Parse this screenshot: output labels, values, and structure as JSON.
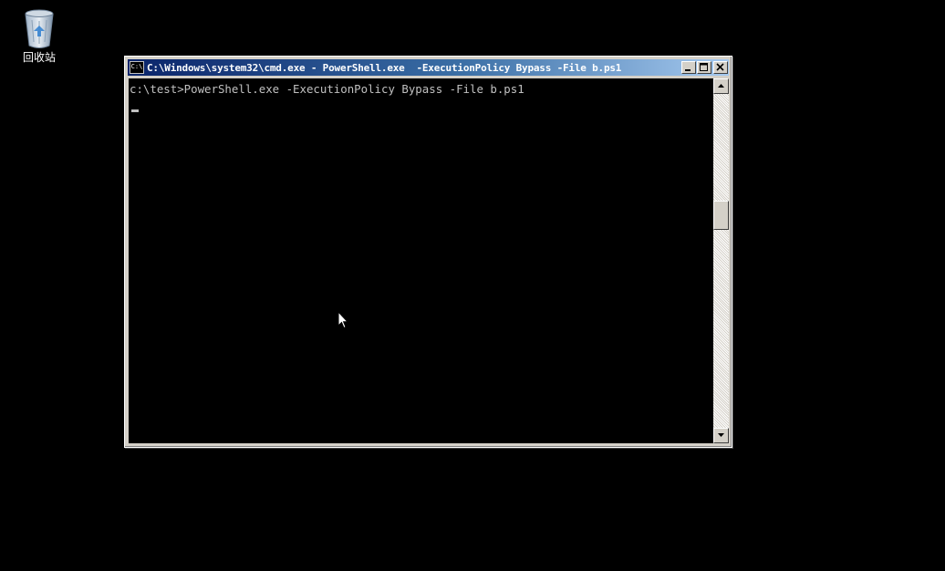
{
  "desktop": {
    "recycle_bin": {
      "label": "回收站",
      "icon": "recycle-bin-icon"
    }
  },
  "window": {
    "title": "C:\\Windows\\system32\\cmd.exe - PowerShell.exe  -ExecutionPolicy Bypass -File b.ps1",
    "icon_text": "C:\\",
    "buttons": [
      "minimize",
      "maximize",
      "close"
    ]
  },
  "console": {
    "lines": [
      "c:\\test>PowerShell.exe -ExecutionPolicy Bypass -File b.ps1"
    ],
    "colors": {
      "background": "#000000",
      "foreground": "#c0c0c0"
    }
  }
}
